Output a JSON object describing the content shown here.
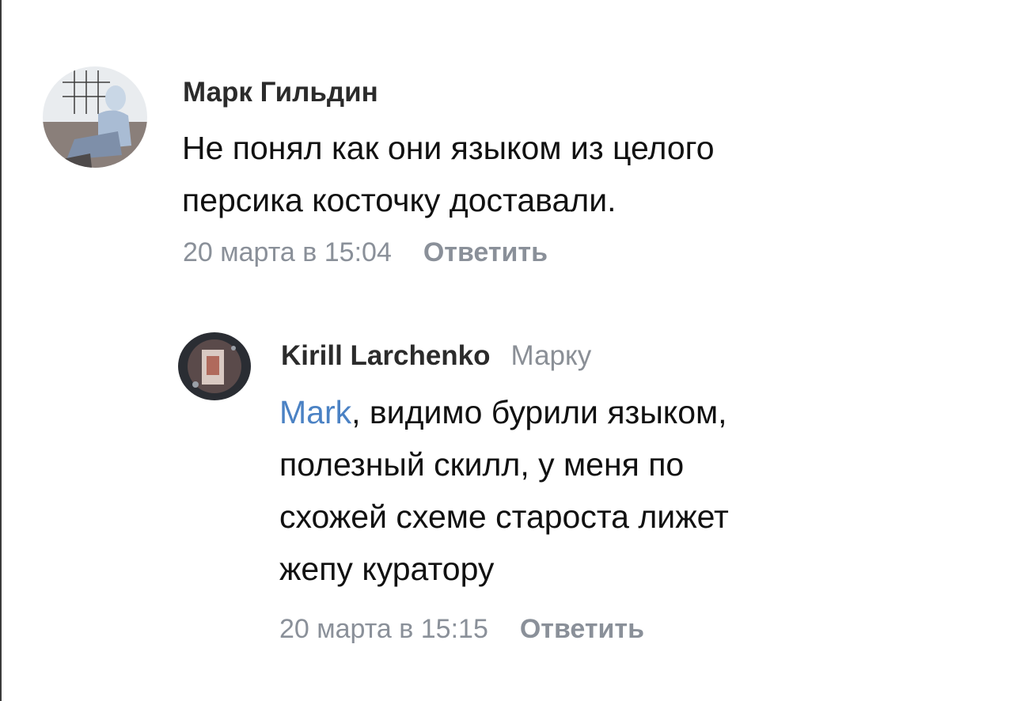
{
  "comments": [
    {
      "author": "Марк Гильдин",
      "text_lines": [
        "Не понял как они языком из целого",
        "персика косточку доставали."
      ],
      "date": "20 марта в 15:04",
      "reply_label": "Ответить"
    },
    {
      "author": "Kirill Larchenko",
      "reply_to": "Марку",
      "mention": "Mark",
      "text_lines": [
        ", видимо бурили языком,",
        "полезный скилл, у меня по",
        "схожей схеме староста лижет",
        "жепу куратору"
      ],
      "date": "20 марта в 15:15",
      "reply_label": "Ответить"
    }
  ],
  "colors": {
    "mention": "#4b82c4",
    "meta": "#8a9099",
    "author": "#2b2b2b",
    "text": "#111111"
  }
}
